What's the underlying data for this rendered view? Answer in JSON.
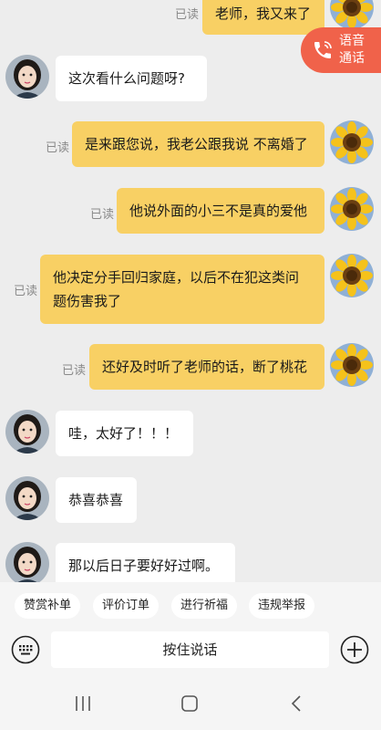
{
  "messages": [
    {
      "side": "mine",
      "text": "老师，我又来了",
      "read": "已读"
    },
    {
      "side": "theirs",
      "text": "这次看什么问题呀?"
    },
    {
      "side": "mine",
      "text": "是来跟您说，我老公跟我说 不离婚了",
      "read": "已读"
    },
    {
      "side": "mine",
      "text": "他说外面的小三不是真的爱他",
      "read": "已读"
    },
    {
      "side": "mine",
      "line1": "他决定分手回归家庭，以后不在犯这类问",
      "line2": "题伤害我了",
      "read": "已读"
    },
    {
      "side": "mine",
      "text": "还好及时听了老师的话，断了桃花",
      "read": "已读"
    },
    {
      "side": "theirs",
      "text": "哇，太好了！！！"
    },
    {
      "side": "theirs",
      "text": "恭喜恭喜"
    },
    {
      "side": "theirs",
      "text": "那以后日子要好好过啊。"
    }
  ],
  "call_button": {
    "line1": "语音",
    "line2": "通话",
    "icon": "phone-icon",
    "color": "#f0624a"
  },
  "quick_actions": [
    "赞赏补单",
    "评价订单",
    "进行祈福",
    "违规举报"
  ],
  "input": {
    "hold_to_talk": "按住说话",
    "left_icon": "keyboard-icon",
    "right_icon": "plus-icon"
  },
  "nav": {
    "icons": [
      "recent-apps-icon",
      "home-icon",
      "back-icon"
    ]
  },
  "colors": {
    "mine_bubble": "#f8d064",
    "theirs_bubble": "#ffffff",
    "background": "#ededed"
  }
}
